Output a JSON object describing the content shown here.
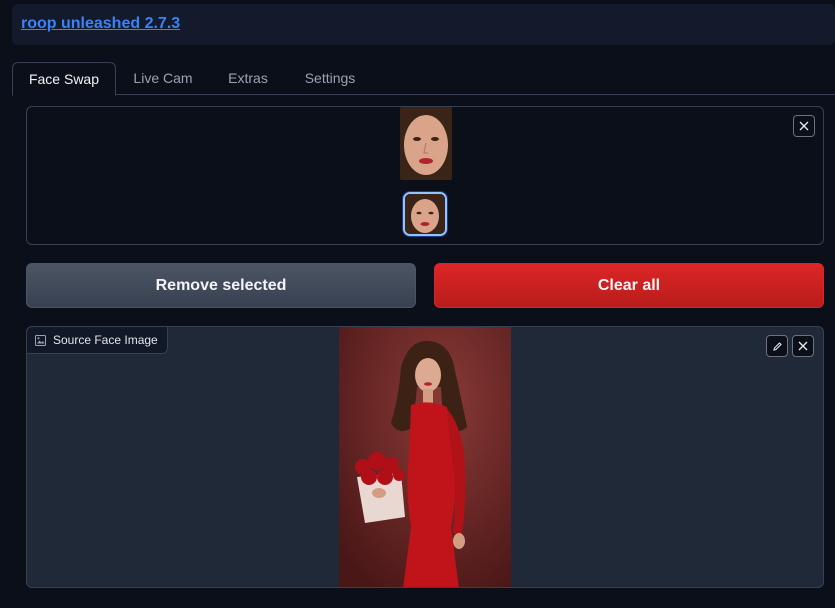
{
  "header": {
    "title": "roop unleashed 2.7.3"
  },
  "tabs": [
    {
      "label": "Face Swap",
      "active": true
    },
    {
      "label": "Live Cam",
      "active": false
    },
    {
      "label": "Extras",
      "active": false
    },
    {
      "label": "Settings",
      "active": false
    }
  ],
  "gallery": {
    "close_icon": "close-icon"
  },
  "buttons": {
    "remove_selected": "Remove selected",
    "clear_all": "Clear all"
  },
  "source_panel": {
    "label": "Source Face Image",
    "label_icon": "image-icon",
    "edit_icon": "pencil-icon",
    "close_icon": "close-icon"
  },
  "colors": {
    "background": "#0b0f19",
    "link": "#3b82f6",
    "danger": "#dc2626",
    "secondary": "#4b5563"
  }
}
